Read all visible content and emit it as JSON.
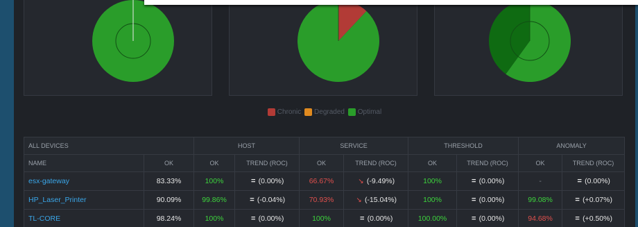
{
  "colors": {
    "chronic": "#b23b36",
    "degraded": "#e08a1f",
    "optimal": "#2a9d2a",
    "optimal_dark": "#0f6b12",
    "link": "#3aa6e8",
    "ok_green": "#3dd33d",
    "ok_red": "#e0504d"
  },
  "chart_data": [
    {
      "type": "pie",
      "labels": [
        "Optimal"
      ],
      "values": [
        100
      ]
    },
    {
      "type": "pie",
      "labels": [
        "Chronic",
        "Optimal"
      ],
      "values": [
        12,
        88
      ]
    },
    {
      "type": "pie",
      "labels": [
        "Optimal",
        "Optimal"
      ],
      "values": [
        60,
        40
      ]
    }
  ],
  "legend": [
    {
      "label": "Chronic",
      "color": "#b23b36"
    },
    {
      "label": "Degraded",
      "color": "#e08a1f"
    },
    {
      "label": "Optimal",
      "color": "#2a9d2a"
    }
  ],
  "table": {
    "group_headers": [
      "ALL DEVICES",
      "HOST",
      "SERVICE",
      "THRESHOLD",
      "ANOMALY"
    ],
    "col_headers": [
      "NAME",
      "OK",
      "OK",
      "TREND (ROC)",
      "OK",
      "TREND (ROC)",
      "OK",
      "TREND (ROC)",
      "OK",
      "TREND (ROC)"
    ],
    "rows": [
      {
        "name": "esx-gateway",
        "ok": "83.33%",
        "host_ok": "100%",
        "host_trend": "(0.00%)",
        "host_dir": "eq",
        "service_ok": "66.67%",
        "service_trend": "(-9.49%)",
        "service_dir": "down",
        "threshold_ok": "100%",
        "threshold_trend": "(0.00%)",
        "threshold_dir": "eq",
        "anomaly_ok": "-",
        "anomaly_trend": "(0.00%)",
        "anomaly_dir": "eq"
      },
      {
        "name": "HP_Laser_Printer",
        "ok": "90.09%",
        "host_ok": "99.86%",
        "host_trend": "(-0.04%)",
        "host_dir": "eq",
        "service_ok": "70.93%",
        "service_trend": "(-15.04%)",
        "service_dir": "down",
        "threshold_ok": "100%",
        "threshold_trend": "(0.00%)",
        "threshold_dir": "eq",
        "anomaly_ok": "99.08%",
        "anomaly_trend": "(+0.07%)",
        "anomaly_dir": "eq"
      },
      {
        "name": "TL-CORE",
        "ok": "98.24%",
        "host_ok": "100%",
        "host_trend": "(0.00%)",
        "host_dir": "eq",
        "service_ok": "100%",
        "service_trend": "(0.00%)",
        "service_dir": "eq",
        "threshold_ok": "100.00%",
        "threshold_trend": "(0.00%)",
        "threshold_dir": "eq",
        "anomaly_ok": "94.68%",
        "anomaly_trend": "(+0.50%)",
        "anomaly_dir": "eq"
      }
    ]
  }
}
